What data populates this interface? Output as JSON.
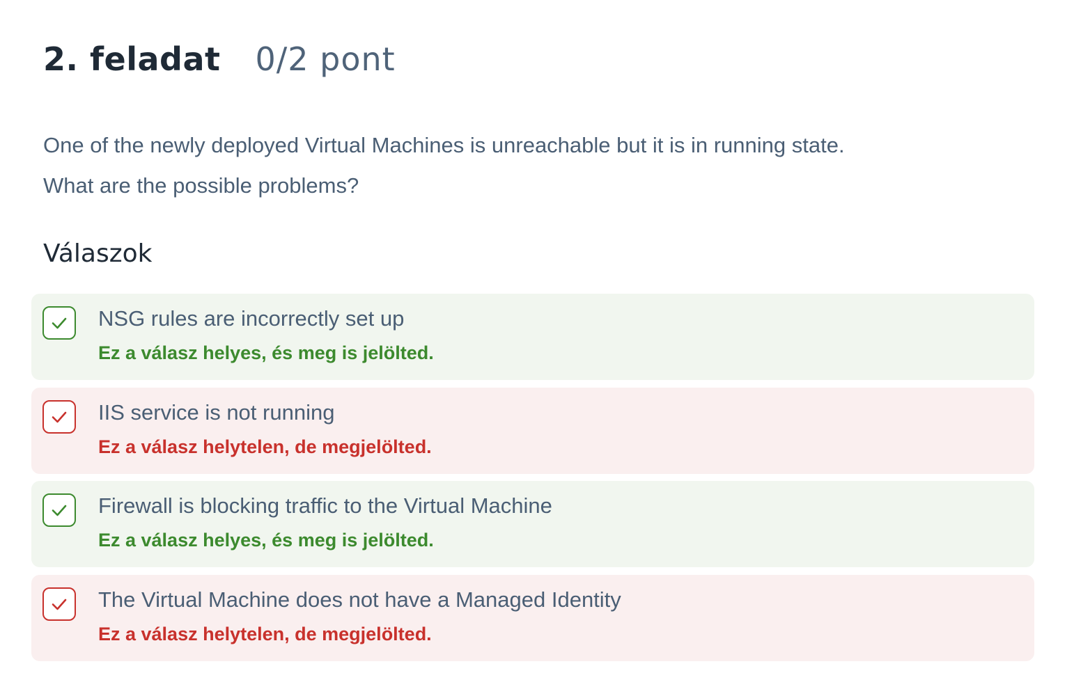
{
  "task": {
    "title": "2. feladat",
    "points": "0/2 pont"
  },
  "question": {
    "lines": [
      "One of the newly deployed Virtual Machines is unreachable but it is in running state.",
      "What are the possible problems?"
    ]
  },
  "answers_heading": "Válaszok",
  "answers": [
    {
      "text": "NSG rules are incorrectly set up",
      "feedback": "Ez a válasz helyes, és meg is jelölted.",
      "status": "correct",
      "checked": true
    },
    {
      "text": "IIS service is not running",
      "feedback": "Ez a válasz helytelen, de megjelölted.",
      "status": "wrong",
      "checked": true
    },
    {
      "text": "Firewall is blocking traffic to the Virtual Machine",
      "feedback": "Ez a válasz helyes, és meg is jelölted.",
      "status": "correct",
      "checked": true
    },
    {
      "text": "The Virtual Machine does not have a Managed Identity",
      "feedback": "Ez a válasz helytelen, de megjelölted.",
      "status": "wrong",
      "checked": true
    }
  ],
  "colors": {
    "correct": "#3c8a2e",
    "correct_bg": "#f1f6ef",
    "wrong": "#c8312c",
    "wrong_bg": "#faefef",
    "text": "#4a5e74",
    "heading": "#1f2a36"
  },
  "icons": {
    "checkbox_mark": "checkmark-icon"
  }
}
